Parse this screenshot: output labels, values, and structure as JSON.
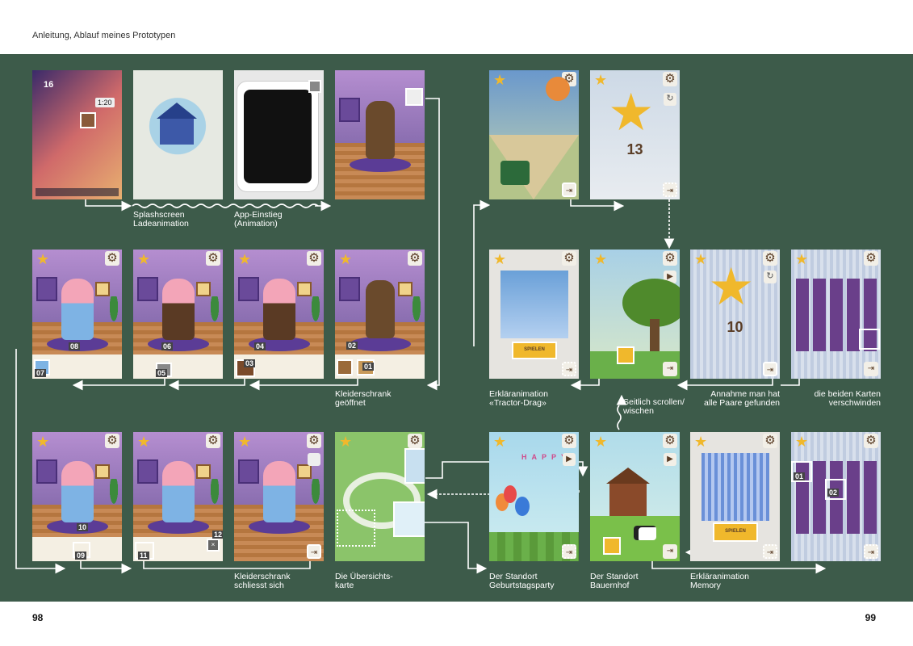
{
  "header": "Anleitung, Ablauf meines Prototypen",
  "page_left": "98",
  "page_right": "99",
  "captions": {
    "splash": [
      "Splashscreen",
      "Ladeanimation"
    ],
    "einstieg": [
      "App-Einstieg",
      "(Animation)"
    ],
    "schrank_offen": [
      "Kleiderschrank",
      "geöffnet"
    ],
    "schrank_zu": [
      "Kleiderschrank",
      "schliesst sich"
    ],
    "karte": [
      "Die Übersichts-",
      "karte"
    ],
    "tractor": [
      "Erkläranimation",
      "«Tractor-Drag»"
    ],
    "scroll": [
      "Seitlich scrollen/",
      "wischen"
    ],
    "paare": [
      "Annahme man hat",
      "alle Paare gefunden"
    ],
    "karten_weg": [
      "die beiden Karten",
      "verschwinden"
    ],
    "party": [
      "Der Standort",
      "Geburtstagsparty"
    ],
    "bauernhof": [
      "Der Standort",
      "Bauernhof"
    ],
    "memory": [
      "Erkläranimation",
      "Memory"
    ]
  },
  "screens": {
    "ipad_time": "1:20",
    "ipad_date": "16",
    "score_13": "13",
    "score_10": "10",
    "spielen": "SPIELEN",
    "banner": "HAPPY"
  },
  "tags": {
    "t01": "01",
    "t02": "02",
    "t03": "03",
    "t04": "04",
    "t05": "05",
    "t06": "06",
    "t07": "07",
    "t08": "08",
    "t09": "09",
    "t10": "10",
    "t11": "11",
    "t12": "12",
    "m01": "01",
    "m02": "02"
  },
  "colors": {
    "board": "#3d5b4a",
    "star": "#f0b82c",
    "memory_tile": "#6a3f8a"
  }
}
